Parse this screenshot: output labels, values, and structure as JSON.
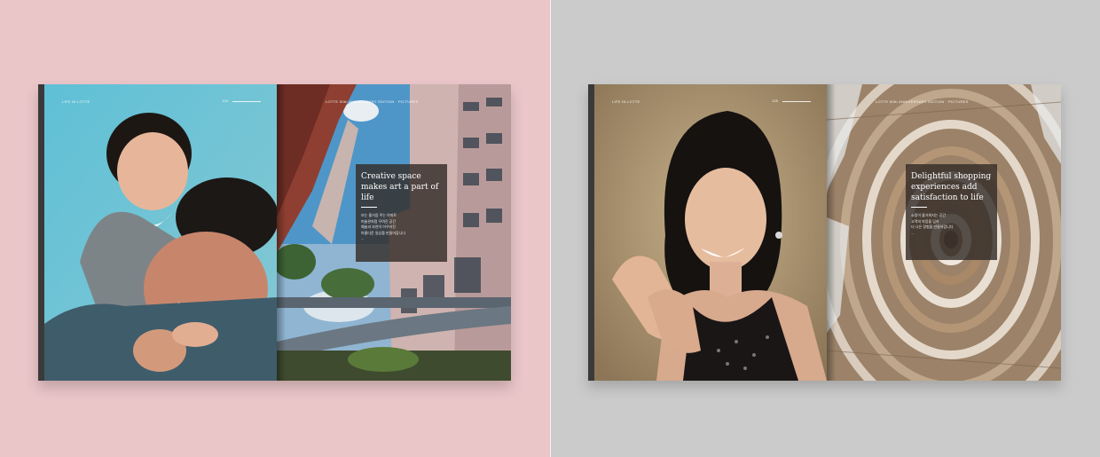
{
  "mockups": [
    {
      "left_page": {
        "running_head": "LIFE IN LOTTE",
        "page_number": "124"
      },
      "right_page": {
        "running_head": "LOTTE 50th ANNIVERSARY EDITION · PICTURES",
        "caption_title": "Creative space makes art a part of life",
        "caption_body": "보는 즐거움 주는 아파트\n미술관처럼 꾸며진 공간\n예술과 자연이 어우러진\n아름다운 일상을 만들어갑니다\n..."
      }
    },
    {
      "left_page": {
        "running_head": "LIFE IN LOTTE",
        "page_number": "125"
      },
      "right_page": {
        "running_head": "LOTTE 50th ANNIVERSARY EDITION · PICTURES",
        "caption_title": "Delightful shopping experiences add satisfaction to life",
        "caption_body": "쇼핑이 즐거워지는 공간\n고객의 마음을 담아\n더 나은 경험을 만들어갑니다\n..."
      }
    }
  ],
  "colors": {
    "left_background": "#eac6c9",
    "right_background": "#cbcbcb",
    "caption_box": "#342d28"
  }
}
